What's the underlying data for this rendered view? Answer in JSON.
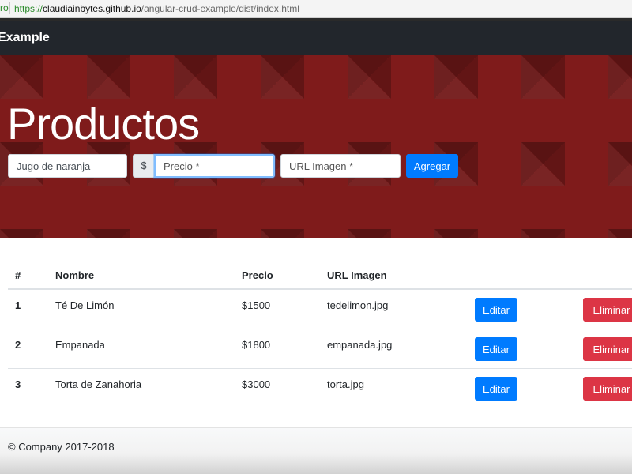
{
  "browser": {
    "tab_fragment": "ro",
    "url_scheme": "https://",
    "url_host": "claudiainbytes.github.io",
    "url_path": "/angular-crud-example/dist/index.html"
  },
  "navbar": {
    "brand": "Example"
  },
  "hero": {
    "title": "Productos"
  },
  "form": {
    "name_value": "Jugo de naranja",
    "currency_addon": "$",
    "price_placeholder": "Precio *",
    "url_placeholder": "URL Imagen *",
    "add_label": "Agregar"
  },
  "table": {
    "headers": [
      "#",
      "Nombre",
      "Precio",
      "URL Imagen"
    ],
    "rows": [
      {
        "num": "1",
        "name": "Té De Limón",
        "price": "$1500",
        "image": "tedelimon.jpg",
        "edit": "Editar",
        "delete": "Eliminar"
      },
      {
        "num": "2",
        "name": "Empanada",
        "price": "$1800",
        "image": "empanada.jpg",
        "edit": "Editar",
        "delete": "Eliminar"
      },
      {
        "num": "3",
        "name": "Torta de Zanahoria",
        "price": "$3000",
        "image": "torta.jpg",
        "edit": "Editar",
        "delete": "Eliminar"
      }
    ]
  },
  "footer": {
    "copyright": "© Company 2017-2018"
  },
  "colors": {
    "primary": "#007bff",
    "danger": "#dc3545",
    "navbar": "#22262c",
    "hero": "#7f1b1b"
  }
}
